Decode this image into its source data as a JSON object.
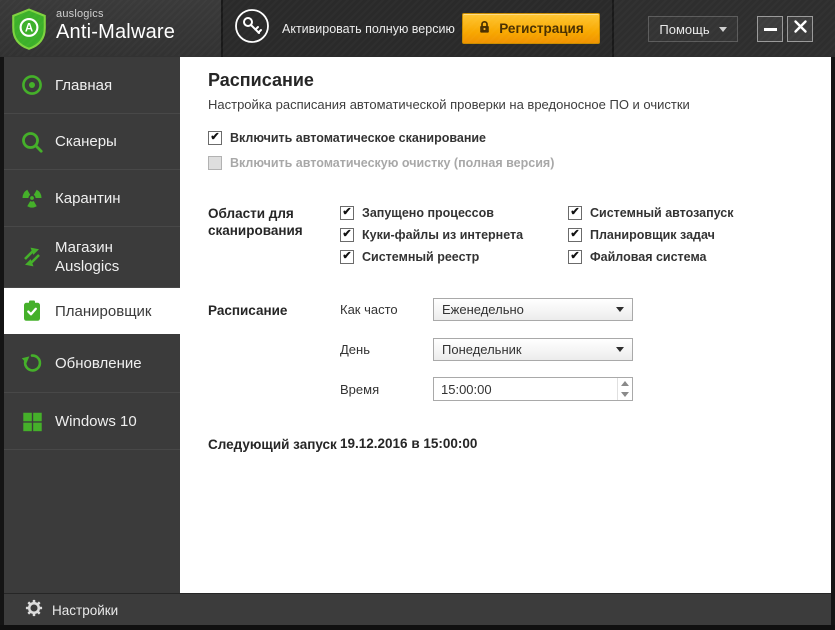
{
  "colors": {
    "accent_green": "#45b02a",
    "register_gradient_top": "#ffc734",
    "register_gradient_bottom": "#f09200",
    "register_text": "#4a3000",
    "topbar_bg": "#2b2b2b",
    "sidebar_item_bg": "#3b3b3b",
    "selected_item_bg": "#ffffff",
    "footer_bg": "#3c3c3c",
    "content_bg": "#ffffff"
  },
  "topbar": {
    "brand_small": "auslogics",
    "brand_large": "Anti-Malware",
    "activate_label": "Активировать полную версию",
    "register_label": "Регистрация",
    "help_label": "Помощь"
  },
  "sidebar": {
    "items": [
      {
        "label": "Главная"
      },
      {
        "label": "Сканеры"
      },
      {
        "label": "Карантин"
      },
      {
        "label": "Магазин",
        "label2": "Auslogics"
      },
      {
        "label": "Планировщик",
        "selected": true
      },
      {
        "label": "Обновление"
      },
      {
        "label": "Windows 10"
      }
    ]
  },
  "footer": {
    "settings_label": "Настройки"
  },
  "main": {
    "title": "Расписание",
    "subtitle": "Настройка расписания автоматической проверки на вредоносное ПО и очистки",
    "toggles": [
      {
        "label": "Включить автоматическое сканирование",
        "checked": true,
        "enabled": true
      },
      {
        "label": "Включить автоматическую очистку (полная версия)",
        "checked": false,
        "enabled": false
      }
    ],
    "scan_areas": {
      "label": "Области для сканирования",
      "column1": [
        "Запущено процессов",
        "Куки-файлы из интернета",
        "Системный реестр"
      ],
      "column2": [
        "Системный автозапуск",
        "Планировщик задач",
        "Файловая система"
      ]
    },
    "schedule": {
      "label": "Расписание",
      "frequency_label": "Как часто",
      "frequency_value": "Еженедельно",
      "day_label": "День",
      "day_value": "Понедельник",
      "time_label": "Время",
      "time_value": "15:00:00"
    },
    "next_run": {
      "label": "Следующий запуск",
      "value": "19.12.2016 в 15:00:00"
    }
  },
  "glyphs": {
    "check": "✔"
  }
}
